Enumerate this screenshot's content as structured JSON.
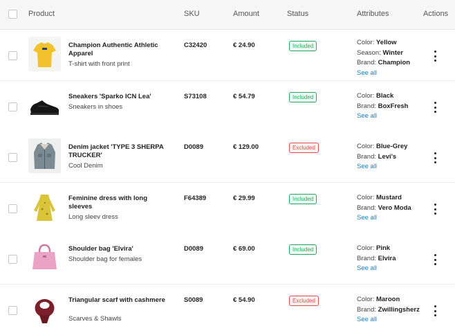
{
  "header": {
    "product": "Product",
    "sku": "SKU",
    "amount": "Amount",
    "status": "Status",
    "attributes": "Attributes",
    "actions": "Actions"
  },
  "colors": {
    "included": "#1eaa5a",
    "excluded": "#e04a4a",
    "link": "#1a7fc0"
  },
  "rows": [
    {
      "name": "Champion Authentic Athletic Apparel",
      "description": "T-shirt with front print",
      "sku": "C32420",
      "amount": "€ 24.90",
      "status": "Included",
      "attributes": [
        {
          "key": "Color:",
          "value": "Yellow"
        },
        {
          "key": "Season:",
          "value": "Winter"
        },
        {
          "key": "Brand:",
          "value": "Champion"
        }
      ],
      "see_all": "See all",
      "image_icon": "tshirt-icon"
    },
    {
      "name": "Sneakers 'Sparko ICN Lea'",
      "description": "Sneakers in shoes",
      "sku": "S73108",
      "amount": "€ 54.79",
      "status": "Included",
      "attributes": [
        {
          "key": "Color:",
          "value": "Black"
        },
        {
          "key": "Brand:",
          "value": "BoxFresh"
        }
      ],
      "see_all": "See all",
      "image_icon": "sneaker-icon"
    },
    {
      "name": "Denim jacket 'TYPE 3 SHERPA TRUCKER'",
      "description": "Cool Denim",
      "sku": "D0089",
      "amount": "€ 129.00",
      "status": "Excluded",
      "attributes": [
        {
          "key": "Color:",
          "value": "Blue-Grey"
        },
        {
          "key": "Brand:",
          "value": "Levi's"
        }
      ],
      "see_all": "See all",
      "image_icon": "jacket-icon"
    },
    {
      "name": "Feminine dress with long sleeves",
      "description": "Long sleev dress",
      "sku": "F64389",
      "amount": "€ 29.99",
      "status": "Included",
      "attributes": [
        {
          "key": "Color:",
          "value": "Mustard"
        },
        {
          "key": "Brand:",
          "value": "Vero Moda"
        }
      ],
      "see_all": "See all",
      "image_icon": "dress-icon"
    },
    {
      "name": "Shoulder bag 'Elvira'",
      "description": "Shoulder bag for females",
      "sku": "D0089",
      "amount": "€ 69.00",
      "status": "Included",
      "attributes": [
        {
          "key": "Color:",
          "value": "Pink"
        },
        {
          "key": "Brand:",
          "value": "Elvira"
        }
      ],
      "see_all": "See all",
      "image_icon": "handbag-icon"
    },
    {
      "name": "Triangular scarf with cashmere",
      "description": "Scarves & Shawls",
      "sku": "S0089",
      "amount": "€ 54.90",
      "status": "Excluded",
      "attributes": [
        {
          "key": "Color:",
          "value": "Maroon"
        },
        {
          "key": "Brand:",
          "value": "Zwillingsherz"
        }
      ],
      "see_all": "See all",
      "image_icon": "scarf-icon"
    }
  ]
}
